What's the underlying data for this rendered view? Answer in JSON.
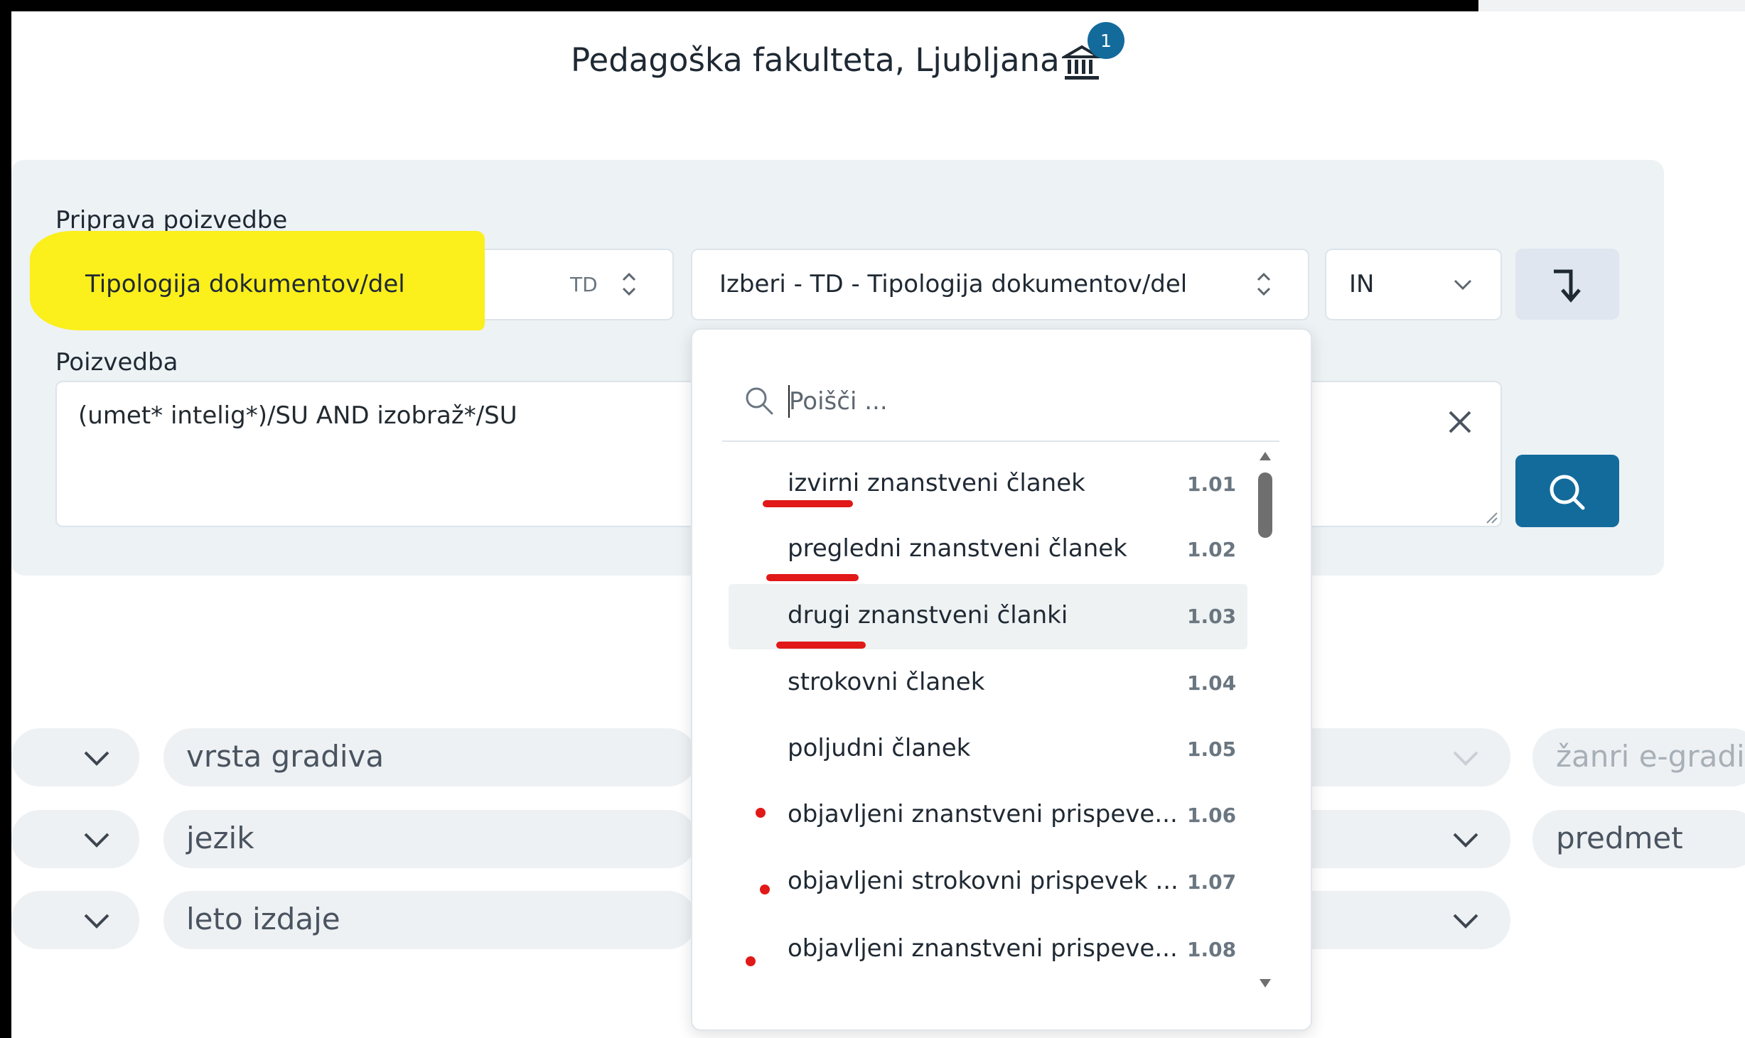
{
  "header": {
    "title": "Pedagoška fakulteta, Ljubljana",
    "badge": "1"
  },
  "query_builder": {
    "section_label": "Priprava poizvedbe",
    "field_select": {
      "value": "Tipologija dokumentov/del",
      "code": "TD"
    },
    "value_select": {
      "value": "Izberi - TD - Tipologija dokumentov/del"
    },
    "operator_select": {
      "value": "IN"
    },
    "query_label": "Poizvedba",
    "query_value": "(umet* intelig*)/SU AND izobraž*/SU"
  },
  "dropdown": {
    "search_placeholder": "Poišči ...",
    "options": [
      {
        "label": "izvirni znanstveni članek",
        "code": "1.01"
      },
      {
        "label": "pregledni znanstveni članek",
        "code": "1.02"
      },
      {
        "label": "drugi znanstveni članki",
        "code": "1.03"
      },
      {
        "label": "strokovni članek",
        "code": "1.04"
      },
      {
        "label": "poljudni članek",
        "code": "1.05"
      },
      {
        "label": "objavljeni znanstveni prispeve...",
        "code": "1.06"
      },
      {
        "label": "objavljeni strokovni prispevek ...",
        "code": "1.07"
      },
      {
        "label": "objavljeni znanstveni prispeve...",
        "code": "1.08"
      }
    ]
  },
  "filters": {
    "left": [
      "vrsta gradiva",
      "jezik",
      "leto izdaje"
    ],
    "right": [
      "žanri e-gradiv",
      "predmet"
    ]
  },
  "icons": {
    "institution": "institution-icon",
    "chevron_up_down": "chevron-up-down-icon",
    "chevron_down": "chevron-down-icon",
    "return_arrow": "return-arrow-icon",
    "close": "close-icon",
    "search": "search-icon"
  },
  "colors": {
    "accent": "#136b9c",
    "highlight": "#fbef1c",
    "annotation": "#e11919",
    "panel": "#edf2f5"
  }
}
